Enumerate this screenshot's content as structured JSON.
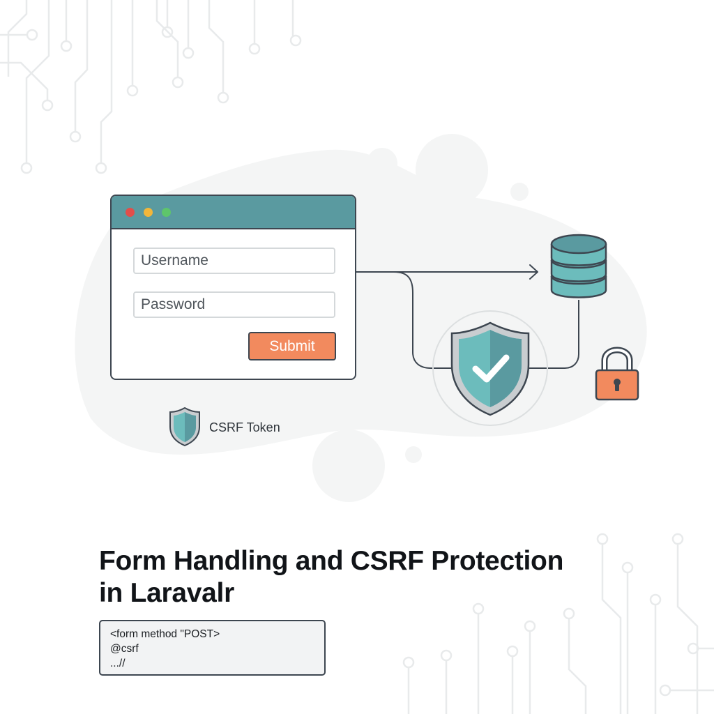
{
  "browser_window": {
    "controls": [
      "close-dot",
      "minimize-dot",
      "maximize-dot"
    ],
    "colors": {
      "titlebar": "#5a9aa0",
      "close": "#e24e4a",
      "minimize": "#f2b63a",
      "maximize": "#5ec56b"
    }
  },
  "form": {
    "username_placeholder": "Username",
    "password_placeholder": "Password",
    "submit_label": "Submit",
    "submit_color": "#f28a5e"
  },
  "token": {
    "label": "CSRF Token",
    "icon": "shield-icon"
  },
  "icons": [
    "database-icon",
    "shield-check-icon",
    "padlock-icon",
    "arrow-right-icon"
  ],
  "title": {
    "line1": "Form Handling and CSRF Protection",
    "line2": "in Laravalr"
  },
  "code": {
    "lines": [
      "<form method \"POST>",
      "@csrf",
      "...//"
    ]
  },
  "accent_colors": {
    "teal": "#6cbcbc",
    "orange": "#f28a5e",
    "outline": "#3d4650"
  }
}
